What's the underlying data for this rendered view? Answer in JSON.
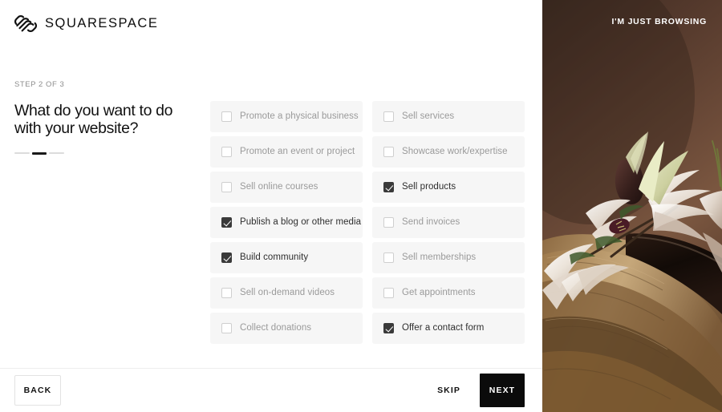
{
  "brand": {
    "name": "SQUARESPACE",
    "logo_icon": "squarespace-logo-icon"
  },
  "intro": {
    "step_label": "STEP 2 OF 3",
    "headline": "What do you want to do with your website?",
    "progress": {
      "total": 3,
      "current": 2
    }
  },
  "options": [
    {
      "label": "Promote a physical business",
      "checked": false
    },
    {
      "label": "Sell services",
      "checked": false
    },
    {
      "label": "Promote an event or project",
      "checked": false
    },
    {
      "label": "Showcase work/expertise",
      "checked": false
    },
    {
      "label": "Sell online courses",
      "checked": false
    },
    {
      "label": "Sell products",
      "checked": true
    },
    {
      "label": "Publish a blog or other media",
      "checked": true
    },
    {
      "label": "Send invoices",
      "checked": false
    },
    {
      "label": "Build community",
      "checked": true
    },
    {
      "label": "Sell memberships",
      "checked": false
    },
    {
      "label": "Sell on-demand videos",
      "checked": false
    },
    {
      "label": "Get appointments",
      "checked": false
    },
    {
      "label": "Collect donations",
      "checked": false
    },
    {
      "label": "Offer a contact form",
      "checked": true
    }
  ],
  "footer": {
    "back_label": "BACK",
    "skip_label": "SKIP",
    "next_label": "NEXT"
  },
  "image_pane": {
    "browse_label": "I'M JUST BROWSING",
    "description": "white lily flowers over a wooden bowl on a dark brown background"
  },
  "colors": {
    "accent_dark": "#0b0b0b",
    "option_bg": "#f6f6f6",
    "option_text": "#9a9a9a",
    "option_text_checked": "#2e2e2e",
    "checkbox_checked": "#3a3a3a",
    "image_backdrop": "#4a342a",
    "progress_active": "#1a1a1a",
    "progress_inactive": "#dcdcdc"
  }
}
